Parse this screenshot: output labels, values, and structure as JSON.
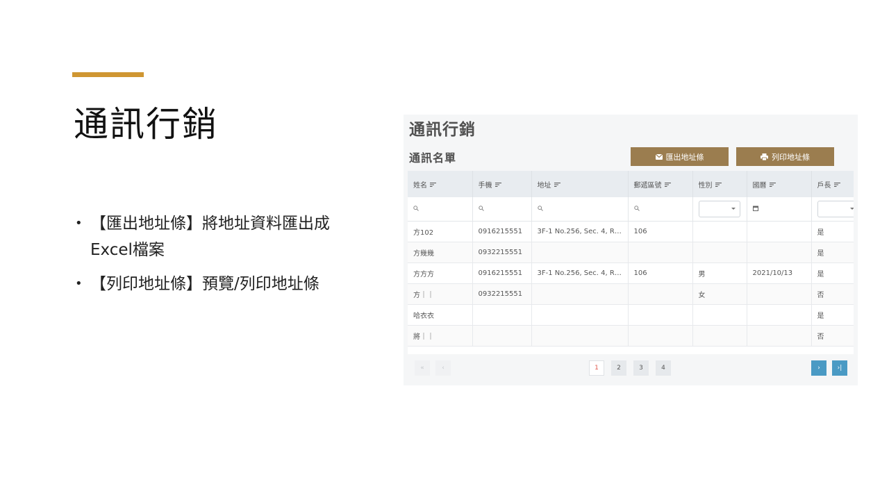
{
  "slide": {
    "title": "通訊行銷",
    "bullets": [
      "【匯出地址條】將地址資料匯出成Excel檔案",
      "【列印地址條】預覽/列印地址條"
    ],
    "accent_color": "#cf9632"
  },
  "screenshot": {
    "app_title": "通訊行銷",
    "section_title": "通訊名單",
    "buttons": {
      "export_label": "匯出地址條",
      "export_icon": "envelope-icon",
      "print_label": "列印地址條",
      "print_icon": "printer-icon",
      "color": "#9b7d4f"
    },
    "table": {
      "columns": [
        "姓名",
        "手機",
        "地址",
        "郵遞區號",
        "性別",
        "國曆",
        "戶長"
      ],
      "rows": [
        [
          "方102",
          "0916215551",
          "3F-1 No.256, Sec. 4, Rd. S...",
          "106",
          "",
          "",
          "是"
        ],
        [
          "方幾幾",
          "0932215551",
          "",
          "",
          "",
          "",
          "是"
        ],
        [
          "方方方",
          "0916215551",
          "3F-1 No.256, Sec. 4, Rd. S...",
          "106",
          "男",
          "2021/10/13",
          "是"
        ],
        [
          "方｜｜",
          "0932215551",
          "",
          "",
          "女",
          "",
          "否"
        ],
        [
          "哈衣衣",
          "",
          "",
          "",
          "",
          "",
          "是"
        ],
        [
          "將｜｜",
          "",
          "",
          "",
          "",
          "",
          "否"
        ]
      ]
    },
    "pagination": {
      "first_label": "«",
      "prev_label": "‹",
      "pages": [
        "1",
        "2",
        "3",
        "4"
      ],
      "current_page": "1",
      "next_label": "›",
      "last_label": "›|"
    },
    "accent_blue": "#4a9ac4"
  }
}
